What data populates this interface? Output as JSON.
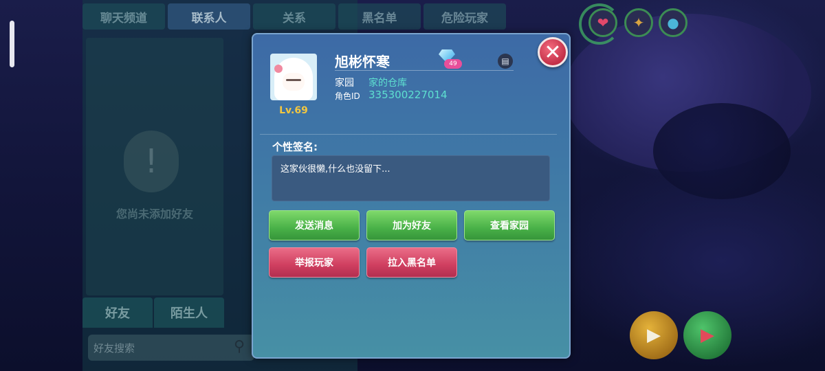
{
  "background_panel": {
    "top_tabs": [
      "聊天频道",
      "联系人",
      "关系",
      "黑名单",
      "危险玩家"
    ],
    "active_tab_index": 1,
    "empty_text": "您尚未添加好友",
    "bottom_tabs": [
      "好友",
      "陌生人"
    ],
    "search_placeholder": "好友搜索"
  },
  "profile": {
    "nickname": "旭彬怀寒",
    "level": "Lv.69",
    "gem_level": "49",
    "home_label": "家园",
    "home_value": "家的仓库",
    "id_label": "角色ID",
    "id_value": "335300227014"
  },
  "signature": {
    "title": "个性签名:",
    "text": "这家伙很懒,什么也没留下..."
  },
  "actions": {
    "send_message": "发送消息",
    "add_friend": "加为好友",
    "view_home": "查看家园",
    "report_player": "举报玩家",
    "blacklist": "拉入黑名单"
  },
  "icons": {
    "close": "close-icon",
    "copy": "copy-icon",
    "heart": "heart-icon",
    "food": "food-icon",
    "water": "water-icon",
    "search": "search-icon"
  },
  "colors": {
    "accent_teal": "#5ee0d0",
    "level_gold": "#f3c740",
    "green_button": "#49b148",
    "red_button": "#cf3e5f"
  }
}
